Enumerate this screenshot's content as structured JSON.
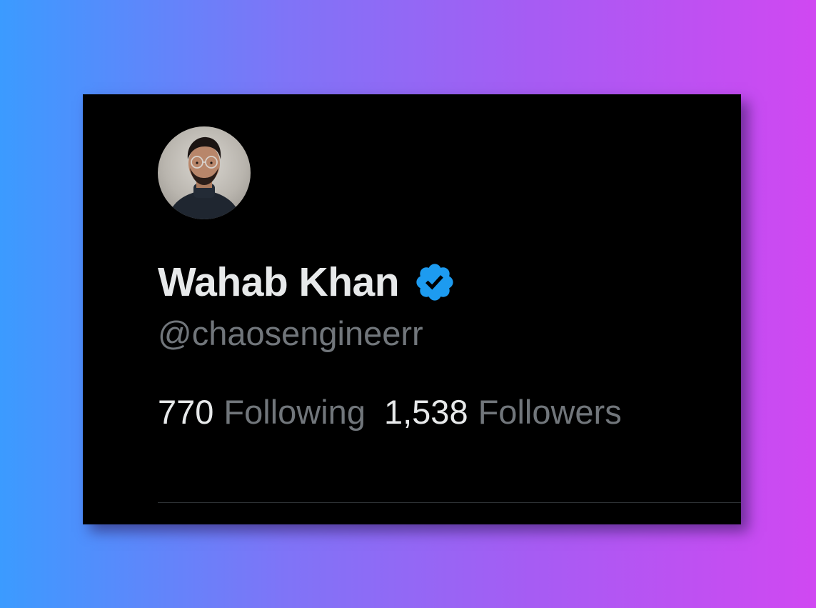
{
  "profile": {
    "display_name": "Wahab Khan",
    "handle": "@chaosengineerr",
    "verified_icon": "verified-badge-icon",
    "verified_color": "#1d9bf0",
    "avatar": "profile-photo"
  },
  "stats": {
    "following_count": "770",
    "following_label": "Following",
    "followers_count": "1,538",
    "followers_label": "Followers"
  },
  "colors": {
    "card_background": "#000000",
    "primary_text": "#e7e9ea",
    "secondary_text": "#71767b",
    "gradient_start": "#3b9bff",
    "gradient_end": "#d048f2"
  }
}
